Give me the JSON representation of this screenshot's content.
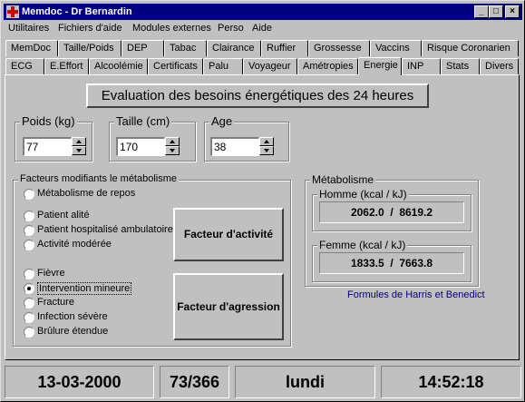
{
  "window": {
    "title": "Memdoc - Dr Bernardin",
    "icon": "medical-cross-icon",
    "controls": {
      "minimize": "_",
      "maximize": "□",
      "close": "×"
    }
  },
  "menu": [
    "Utilitaires",
    "Fichiers d'aide",
    "Modules externes",
    "Perso",
    "Aide"
  ],
  "tabs_row1": [
    "MemDoc",
    "Taille/Poids",
    "DEP",
    "Tabac",
    "Clairance",
    "Ruffier",
    "Grossesse",
    "Vaccins",
    "Risque Coronarien"
  ],
  "tabs_row2": [
    "ECG",
    "E.Effort",
    "Alcoolémie",
    "Certificats",
    "Palu",
    "Voyageur",
    "Amétropies",
    "Energie",
    "INP",
    "Stats",
    "Divers"
  ],
  "active_tab": "Energie",
  "page_title": "Evaluation des besoins énergétiques des 24 heures",
  "inputs": {
    "poids": {
      "label": "Poids (kg)",
      "value": "77"
    },
    "taille": {
      "label": "Taille (cm)",
      "value": "170"
    },
    "age": {
      "label": "Age",
      "value": "38"
    }
  },
  "facteurs": {
    "label": "Facteurs modifiants le métabolisme",
    "options": [
      {
        "label": "Métabolisme de repos",
        "selected": false
      },
      {
        "label": "Patient alité",
        "selected": false
      },
      {
        "label": "Patient hospitalisé ambulatoire",
        "selected": false
      },
      {
        "label": "Activité modérée",
        "selected": false
      },
      {
        "label": "Fièvre",
        "selected": false
      },
      {
        "label": "Intervention mineure",
        "selected": true
      },
      {
        "label": "Fracture",
        "selected": false
      },
      {
        "label": "Infection sévère",
        "selected": false
      },
      {
        "label": "Brûlure étendue",
        "selected": false
      }
    ],
    "btn_activite": "Facteur d'activité",
    "btn_agression": "Facteur d'agression"
  },
  "metabolisme": {
    "label": "Métabolisme",
    "homme_label": "Homme (kcal / kJ)",
    "homme_value": "2062.0  /  8619.2",
    "femme_label": "Femme (kcal / kJ)",
    "femme_value": "1833.5  /  7663.8",
    "formula": "Formules de Harris et Benedict",
    "formula_color": "#000080"
  },
  "status": {
    "date": "13-03-2000",
    "day_of_year": "73/366",
    "weekday": "lundi",
    "time": "14:52:18"
  }
}
